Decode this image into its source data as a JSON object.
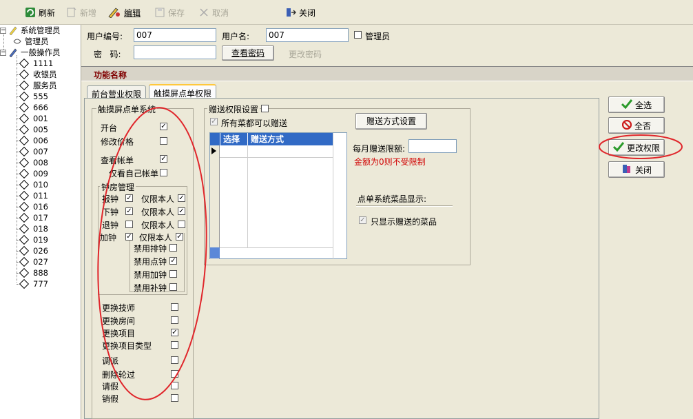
{
  "toolbar": {
    "refresh": "刷新",
    "new": "新增",
    "edit": "编辑",
    "save": "保存",
    "cancel": "取消",
    "close": "关闭"
  },
  "tree": {
    "root1": "系统管理员",
    "root1_child": "管理员",
    "root2": "一般操作员",
    "items": [
      "1111",
      "收银员",
      "服务员",
      "555",
      "666",
      "001",
      "005",
      "006",
      "007",
      "008",
      "009",
      "010",
      "011",
      "016",
      "017",
      "018",
      "019",
      "026",
      "027",
      "888",
      "777"
    ]
  },
  "header": {
    "user_id_label": "用户编号:",
    "user_id_value": "007",
    "user_name_label": "用户名:",
    "user_name_value": "007",
    "admin_label": "管理员",
    "password_label": "密   码:",
    "password_value": "",
    "view_password": "查看密码",
    "change_password": "更改密码"
  },
  "panel_title": "功能名称",
  "tabs": [
    "前台营业权限",
    "触摸屏点单权限"
  ],
  "touch_group": {
    "title": "触摸屏点单系统",
    "items": [
      {
        "label": "开台",
        "checked": true
      },
      {
        "label": "修改价格",
        "checked": false
      },
      {
        "label": "查看帐单",
        "checked": true
      },
      {
        "label": "仅看自己帐单",
        "checked": false
      }
    ],
    "clock_title": "钟房管理",
    "clock_rows": [
      {
        "label": "报钟",
        "checked": true,
        "sub": "仅限本人",
        "sub_checked": true
      },
      {
        "label": "下钟",
        "checked": true,
        "sub": "仅限本人",
        "sub_checked": true
      },
      {
        "label": "退钟",
        "checked": false,
        "sub": "仅限本人",
        "sub_checked": false
      },
      {
        "label": "加钟",
        "checked": true,
        "sub": "仅限本人",
        "sub_checked": true
      }
    ],
    "clock_extra": [
      {
        "label": "禁用排钟",
        "checked": false
      },
      {
        "label": "禁用点钟",
        "checked": true
      },
      {
        "label": "禁用加钟",
        "checked": false
      },
      {
        "label": "禁用补钟",
        "checked": false
      }
    ],
    "more": [
      {
        "label": "更换技师",
        "checked": false
      },
      {
        "label": "更换房间",
        "checked": false
      },
      {
        "label": "更换项目",
        "checked": true
      },
      {
        "label": "更换项目类型",
        "checked": false
      },
      {
        "label": "调派",
        "checked": false
      },
      {
        "label": "删除轮过",
        "checked": false
      },
      {
        "label": "请假",
        "checked": false
      },
      {
        "label": "销假",
        "checked": false
      }
    ]
  },
  "gift_group": {
    "title": "赠送权限设置",
    "all_label": "所有菜都可以赠送",
    "gift_method_button": "赠送方式设置",
    "grid_headers": [
      "选择",
      "赠送方式"
    ],
    "monthly_label": "每月赠送限额:",
    "monthly_value": "",
    "note": "金额为0则不受限制",
    "display_title": "点单系统菜品显示:",
    "only_gift_label": "只显示赠送的菜品"
  },
  "side_buttons": {
    "select_all": "全选",
    "select_none": "全否",
    "change_rights": "更改权限",
    "close": "关闭"
  },
  "colors": {
    "accent_red": "#e0262b",
    "grid_header": "#316ac5",
    "title_text": "#800000"
  }
}
